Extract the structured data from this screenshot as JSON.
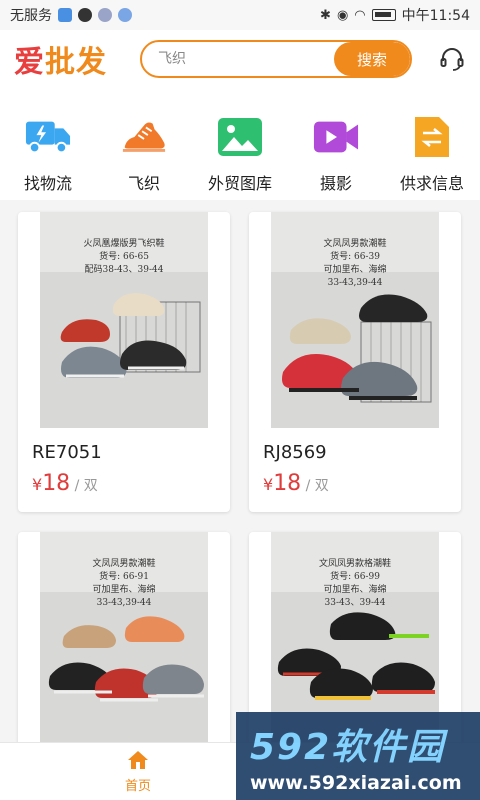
{
  "status_bar": {
    "carrier": "无服务",
    "time": "中午11:54"
  },
  "header": {
    "logo_part1": "爱",
    "logo_part2": "批发",
    "search_placeholder": "飞织",
    "search_button": "搜索",
    "support_icon": "headset-icon"
  },
  "categories": [
    {
      "label": "找物流",
      "icon": "truck-icon",
      "color": "#3aa7f0"
    },
    {
      "label": "飞织",
      "icon": "sneaker-icon",
      "color": "#f07a2a"
    },
    {
      "label": "外贸图库",
      "icon": "picture-icon",
      "color": "#2fbf71"
    },
    {
      "label": "摄影",
      "icon": "video-icon",
      "color": "#b14ad8"
    },
    {
      "label": "供求信息",
      "icon": "exchange-doc-icon",
      "color": "#f5a623"
    }
  ],
  "products": [
    {
      "name": "RE7051",
      "currency": "¥",
      "price": "18",
      "unit": "/ 双",
      "caption": [
        "火凤凰爆版男飞织鞋",
        "货号: 66-65",
        "配码38-43、39-44"
      ]
    },
    {
      "name": "RJ8569",
      "currency": "¥",
      "price": "18",
      "unit": "/ 双",
      "caption": [
        "文凤凤男款潮鞋",
        "货号: 66-39",
        "可加里布、海绵",
        "33-43,39-44"
      ]
    },
    {
      "name": "",
      "caption": [
        "文凤凤男款潮鞋",
        "货号: 66-91",
        "可加里布、海绵",
        "33-43,39-44"
      ]
    },
    {
      "name": "",
      "caption": [
        "文凤凤男款格潮鞋",
        "货号: 66-99",
        "可加里布、海绵",
        "33-43、39-44"
      ]
    }
  ],
  "bottom_nav": {
    "home_label": "首页",
    "home_color": "#f08a1c"
  },
  "watermark": {
    "brand": "592软件园",
    "url": "www.592xiazai.com"
  }
}
